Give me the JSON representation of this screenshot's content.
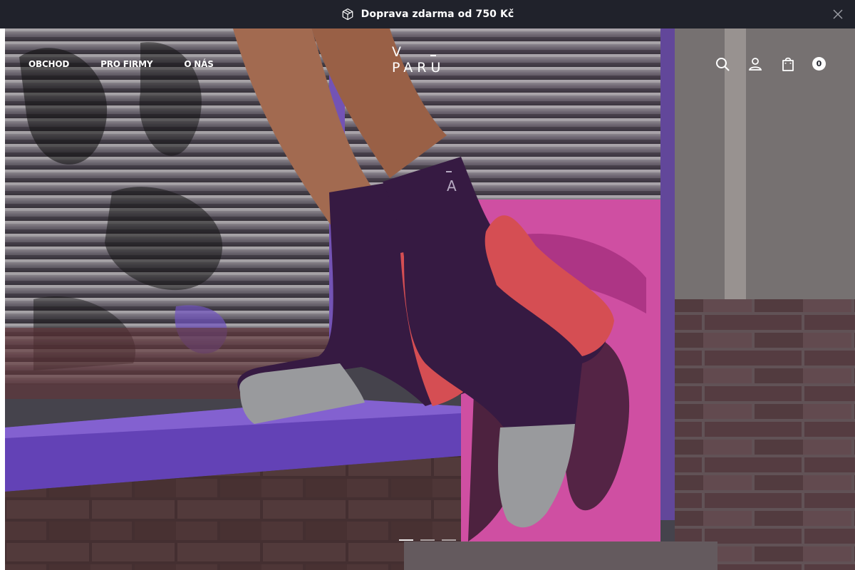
{
  "announcement": {
    "text": "Doprava zdarma od 750 Kč",
    "icon": "package-icon",
    "close_icon": "close-icon"
  },
  "header": {
    "nav": [
      {
        "label": "OBCHOD"
      },
      {
        "label": "PRO FIRMY"
      },
      {
        "label": "O NÁS"
      }
    ],
    "logo": "V PARU",
    "icons": [
      "search-icon",
      "user-icon",
      "bag-icon"
    ],
    "cart_count": "0"
  },
  "hero": {
    "slide_count": 3,
    "active_slide": 1
  },
  "colors": {
    "announce_bg": "#20222b",
    "sock_purple": "#3b1d48",
    "sock_coral": "#e8555b",
    "sock_grey": "#a7a8ab",
    "wall_pink": "#d94aa8"
  }
}
